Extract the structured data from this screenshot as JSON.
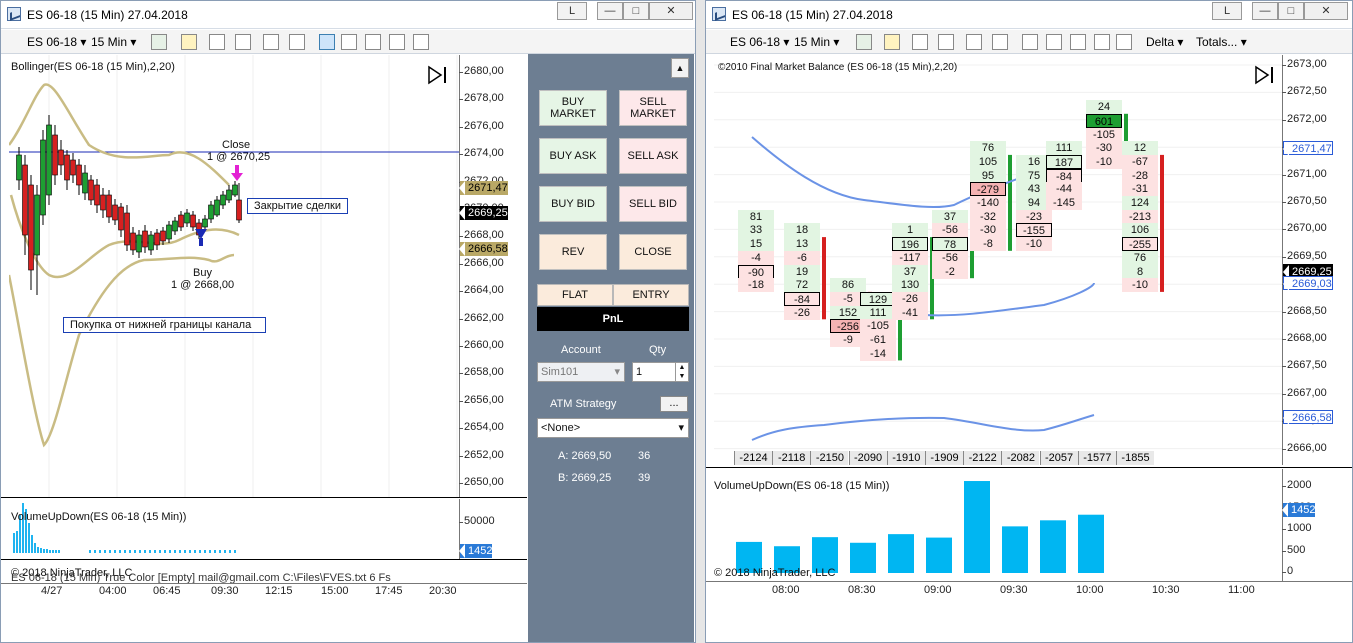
{
  "left_window": {
    "title": "ES 06-18 (15 Min)  27.04.2018",
    "btn_l": "L",
    "toolbar": {
      "instrument": "ES 06-18",
      "interval": "15 Min"
    },
    "indicator_label": "Bollinger(ES 06-18 (15 Min),2,20)",
    "price_axis": [
      "2680,00",
      "2678,00",
      "2676,00",
      "2674,00",
      "2672,00",
      "2670,00",
      "2668,00",
      "2666,00",
      "2664,00",
      "2662,00",
      "2660,00",
      "2658,00",
      "2656,00",
      "2654,00",
      "2652,00",
      "2650,00"
    ],
    "price_tags": [
      {
        "text": "2671,47",
        "color": "#b9a866"
      },
      {
        "text": "2669,25",
        "color": "#000000"
      },
      {
        "text": "2666,58",
        "color": "#b9a866"
      }
    ],
    "close_label": "Close",
    "close_fill": "1 @ 2670,25",
    "buy_label": "Buy",
    "buy_fill": "1 @ 2668,00",
    "close_trade_note": "Закрытие сделки",
    "buy_note": "Покупка от нижней границы канала",
    "volume_label": "VolumeUpDown(ES 06-18 (15 Min))",
    "volume_axis": "50000",
    "volume_tag": "1452",
    "copyright": "© 2018 NinjaTrader, LLC",
    "overlap_text": "ES 06-18 (15 Min) True Color [Empty] mail@gmail.com C:\\Files\\FVES.txt 6 Fs",
    "time_axis": [
      "4/27",
      "04:00",
      "06:45",
      "09:30",
      "12:15",
      "15:00",
      "17:45",
      "20:30"
    ]
  },
  "order_panel": {
    "buy_market": "BUY MARKET",
    "sell_market": "SELL MARKET",
    "buy_ask": "BUY ASK",
    "sell_ask": "SELL ASK",
    "buy_bid": "BUY BID",
    "sell_bid": "SELL BID",
    "rev": "REV",
    "close": "CLOSE",
    "flat": "FLAT",
    "entry": "ENTRY",
    "pnl": "PnL",
    "account_label": "Account",
    "qty_label": "Qty",
    "account_value": "Sim101",
    "qty_value": "1",
    "atm_label": "ATM Strategy",
    "atm_btn": "...",
    "atm_value": "<None>",
    "ask_label": "A: 2669,50",
    "ask_size": "36",
    "bid_label": "B: 2669,25",
    "bid_size": "39"
  },
  "right_window": {
    "title": "ES 06-18 (15 Min)  27.04.2018",
    "btn_l": "L",
    "toolbar": {
      "instrument": "ES 06-18",
      "interval": "15 Min",
      "delta": "Delta",
      "totals": "Totals..."
    },
    "indicator_label": "©2010 Final Market Balance  (ES 06-18 (15 Min),2,20)",
    "price_axis": [
      "2673,00",
      "2672,50",
      "2672,00",
      "2671,50",
      "2671,00",
      "2670,50",
      "2670,00",
      "2669,50",
      "2669,00",
      "2668,50",
      "2668,00",
      "2667,50",
      "2667,00",
      "2666,50",
      "2666,00"
    ],
    "price_tags": [
      {
        "text": "2671,47",
        "color": "#2a5bd7"
      },
      {
        "text": "2669,25",
        "color": "#000000"
      },
      {
        "text": "2669,03",
        "color": "#2a5bd7"
      },
      {
        "text": "2666,58",
        "color": "#2a5bd7"
      }
    ],
    "deltas": [
      "-2124",
      "-2118",
      "-2150",
      "-2090",
      "-1910",
      "-1909",
      "-2122",
      "-2082",
      "-2057",
      "-1577",
      "-1855"
    ],
    "volume_label": "VolumeUpDown(ES 06-18 (15 Min))",
    "volume_axis": [
      "2000",
      "1500",
      "1000",
      "500",
      "0"
    ],
    "volume_tag": "1452",
    "volumes": [
      720,
      620,
      830,
      700,
      900,
      820,
      2130,
      1080,
      1220,
      1350
    ],
    "copyright": "© 2018 NinjaTrader, LLC",
    "time_axis": [
      "08:00",
      "08:30",
      "09:00",
      "09:30",
      "10:00",
      "10:30",
      "11:00"
    ]
  },
  "footprint": [
    {
      "col": 0,
      "cells": [
        [
          "",
          "81",
          0
        ],
        [
          "",
          "33",
          0
        ],
        [
          "",
          "15",
          0
        ],
        [
          "",
          "-4",
          1
        ],
        [
          "",
          "-90",
          1
        ],
        [
          "",
          "-18",
          1
        ]
      ]
    },
    {
      "col": 1,
      "cells": [
        [
          "18",
          "",
          0
        ],
        [
          "13",
          "",
          0
        ],
        [
          "-6",
          "",
          1
        ],
        [
          "19",
          "",
          0
        ],
        [
          "72",
          "",
          0
        ],
        [
          "-84",
          "",
          1
        ],
        [
          "-26",
          "",
          1
        ]
      ]
    },
    {
      "col": 2,
      "cells": [
        [
          "86",
          "",
          0
        ],
        [
          "-5",
          "",
          1
        ],
        [
          "152",
          "",
          0
        ],
        [
          "-256",
          "",
          1
        ],
        [
          "-9",
          "",
          1
        ]
      ]
    },
    {
      "col": 3,
      "cells": [
        [
          "129",
          "",
          0
        ],
        [
          "111",
          "",
          0
        ],
        [
          "-105",
          "",
          1
        ],
        [
          "-61",
          "",
          1
        ],
        [
          "-14",
          "",
          1
        ]
      ]
    },
    {
      "col": 4,
      "cells": [
        [
          "1",
          "",
          0
        ],
        [
          "196",
          "",
          0
        ],
        [
          "-117",
          "",
          1
        ],
        [
          "37",
          "",
          0
        ],
        [
          "130",
          "",
          0
        ],
        [
          "-26",
          "",
          1
        ],
        [
          "-41",
          "",
          1
        ]
      ]
    },
    {
      "col": 5,
      "cells": [
        [
          "37",
          "",
          0
        ],
        [
          "-56",
          "",
          1
        ],
        [
          "78",
          "",
          0
        ],
        [
          "-56",
          "",
          1
        ],
        [
          "-2",
          "",
          1
        ]
      ]
    },
    {
      "col": 6,
      "cells": [
        [
          "76",
          "",
          0
        ],
        [
          "105",
          "",
          0
        ],
        [
          "95",
          "",
          0
        ],
        [
          "-279",
          "",
          1
        ],
        [
          "-140",
          "",
          1
        ],
        [
          "-32",
          "",
          1
        ],
        [
          "-30",
          "",
          1
        ],
        [
          "-8",
          "",
          1
        ]
      ]
    },
    {
      "col": 7,
      "cells": [
        [
          "16",
          "",
          0
        ],
        [
          "75",
          "",
          0
        ],
        [
          "43",
          "",
          0
        ],
        [
          "94",
          "",
          0
        ],
        [
          "-23",
          "",
          1
        ],
        [
          "-155",
          "",
          1
        ],
        [
          "-10",
          "",
          1
        ]
      ]
    },
    {
      "col": 8,
      "cells": [
        [
          "111",
          "",
          0
        ],
        [
          "187",
          "",
          0
        ],
        [
          "-84",
          "",
          1
        ],
        [
          "-44",
          "",
          1
        ],
        [
          "-145",
          "",
          1
        ]
      ]
    },
    {
      "col": 9,
      "cells": [
        [
          "24",
          "",
          0
        ],
        [
          "601",
          "",
          0
        ],
        [
          "-105",
          "",
          1
        ],
        [
          "-30",
          "",
          1
        ],
        [
          "-10",
          "",
          1
        ]
      ]
    },
    {
      "col": 10,
      "cells": [
        [
          "12",
          "",
          0
        ],
        [
          "-67",
          "",
          1
        ],
        [
          "-28",
          "",
          1
        ],
        [
          "-31",
          "",
          1
        ],
        [
          "124",
          "",
          0
        ],
        [
          "-213",
          "",
          1
        ],
        [
          "106",
          "",
          0
        ],
        [
          "-255",
          "",
          1
        ],
        [
          "76",
          "",
          0
        ],
        [
          "8",
          "",
          0
        ],
        [
          "-10",
          "",
          1
        ]
      ]
    }
  ]
}
